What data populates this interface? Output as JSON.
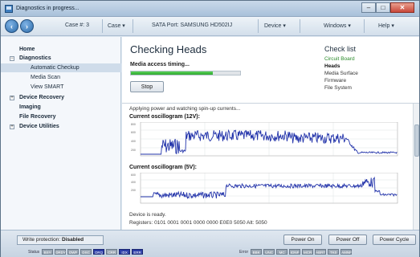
{
  "window": {
    "title": "Diagnostics in progress..."
  },
  "window_buttons": {
    "minimize": "–",
    "maximize": "□",
    "close": "✕"
  },
  "toolbar": {
    "back": "‹",
    "forward": "›",
    "case_label": "Case #: 3",
    "case_menu": "Case ▾",
    "port_label": "SATA Port: SAMSUNG HD502IJ",
    "device_menu": "Device ▾",
    "windows_menu": "Windows ▾",
    "help_menu": "Help ▾"
  },
  "sidebar": {
    "items": [
      {
        "label": "Home"
      },
      {
        "label": "Diagnostics"
      },
      {
        "label": "Automatic Checkup"
      },
      {
        "label": "Media Scan"
      },
      {
        "label": "View SMART"
      },
      {
        "label": "Device Recovery"
      },
      {
        "label": "Imaging"
      },
      {
        "label": "File Recovery"
      },
      {
        "label": "Device Utilities"
      }
    ]
  },
  "main": {
    "title": "Checking Heads",
    "status": "Media access timing...",
    "progress": 0.75,
    "stop_label": "Stop"
  },
  "checklist": {
    "title": "Check list",
    "items": [
      "Circuit Board",
      "Heads",
      "Media Surface",
      "Firmware",
      "File System"
    ],
    "done_count": 1,
    "active_index": 1
  },
  "log": {
    "line1": "Applying power and watching spin-up currents...",
    "osc1_title": "Current oscillogram (12V):",
    "osc2_title": "Current oscillogram (5V):",
    "ready": "Device is ready.",
    "registers": "Registers: 0101 0001 0001 0000 0000 E0E0 5050  Alt: 5050"
  },
  "bottom": {
    "write_protection_label": "Write protection:",
    "write_protection_value": "Disabled",
    "power_on": "Power On",
    "power_off": "Power Off",
    "power_cycle": "Power Cycle"
  },
  "status_regs": {
    "status_label": "Status",
    "status": [
      {
        "name": "BSY",
        "on": false
      },
      {
        "name": "DRDY",
        "on": false
      },
      {
        "name": "DWF",
        "on": false
      },
      {
        "name": "DSC",
        "on": false
      },
      {
        "name": "DRQ",
        "on": true
      },
      {
        "name": "CRR",
        "on": false
      },
      {
        "name": "IDX",
        "on": true
      },
      {
        "name": "ERR",
        "on": true
      }
    ],
    "error_label": "Error",
    "error": [
      {
        "name": "BBK",
        "on": false
      },
      {
        "name": "UNC",
        "on": false
      },
      {
        "name": "MC",
        "on": false
      },
      {
        "name": "IDNF",
        "on": false
      },
      {
        "name": "MCR",
        "on": false
      },
      {
        "name": "ABRT",
        "on": false
      },
      {
        "name": "TK0",
        "on": false
      },
      {
        "name": "AMNF",
        "on": false
      }
    ]
  },
  "colors": {
    "accent": "#2b6aa8",
    "progress": "#2ea62e",
    "trace": "#2233aa",
    "active_reg": "#2c3da8"
  }
}
